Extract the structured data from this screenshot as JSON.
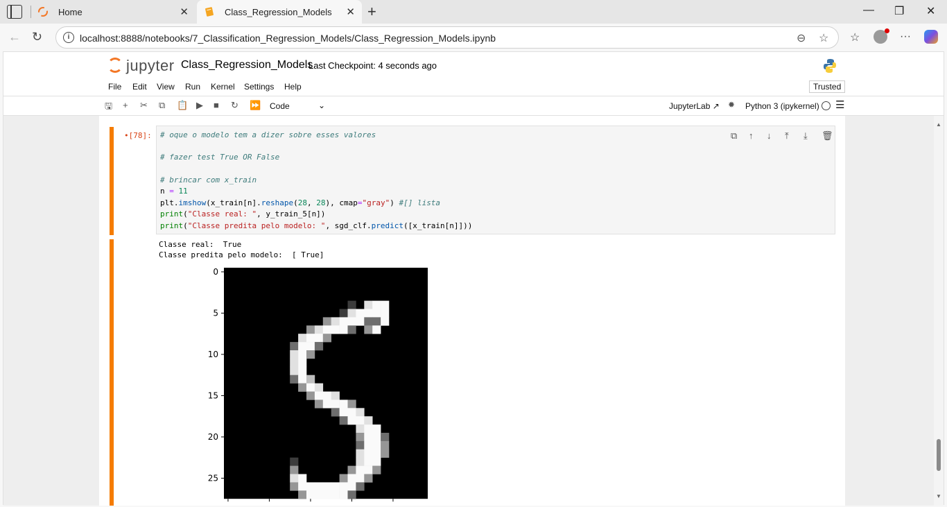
{
  "browser": {
    "tabs": [
      {
        "title": "Home",
        "active": false
      },
      {
        "title": "Class_Regression_Models",
        "active": true
      }
    ],
    "url": "localhost:8888/notebooks/7_Classification_Regression_Models/Class_Regression_Models.ipynb"
  },
  "jupyter": {
    "logo_text": "jupyter",
    "notebook_title": "Class_Regression_Models",
    "checkpoint": "Last Checkpoint: 4 seconds ago",
    "menu": [
      "File",
      "Edit",
      "View",
      "Run",
      "Kernel",
      "Settings",
      "Help"
    ],
    "trusted": "Trusted",
    "cell_type": "Code",
    "jupyterlab_link": "JupyterLab",
    "kernel": "Python 3 (ipykernel)"
  },
  "cell": {
    "prompt": "•[78]:",
    "code": [
      "# oque o modelo tem a dizer sobre esses valores",
      "",
      "# fazer test True OR False",
      "",
      "# brincar com x_train",
      "n = 11",
      "plt.imshow(x_train[n].reshape(28, 28), cmap=\"gray\") #[] lista",
      "print(\"Classe real: \", y_train_5[n])",
      "print(\"Classe predita pelo modelo: \", sgd_clf.predict([x_train[n]]))"
    ],
    "output": [
      "Classe real:  True",
      "Classe predita pelo modelo:  [ True]"
    ]
  },
  "chart_data": {
    "type": "heatmap",
    "title": "",
    "cmap": "gray",
    "ytick_labels": [
      "0",
      "5",
      "10",
      "15",
      "20",
      "25"
    ],
    "ytick_values": [
      0,
      5,
      10,
      15,
      20,
      25
    ],
    "shape": [
      28,
      28
    ],
    "digit_rows": [
      "............................",
      "............................",
      "............................",
      "............................",
      "...............a.eff........",
      "..............aeffff........",
      "............cefffbbf........",
      "..........cefffb.cf.........",
      ".........effc...............",
      "........bffb................",
      "........efc.................",
      "........ef..................",
      "........ef..................",
      "........bfd.................",
      ".........cfe................",
      "..........cffe..............",
      "...........cfffc............",
      ".............bffe...........",
      "..............bffe..........",
      "................eff.........",
      "................cffb........",
      "................bffc........",
      "................effc........",
      "........a.......eff.........",
      "........c......cffc.........",
      "........ef....cffc..........",
      "........cfffffffb...........",
      ".........cfffffb............"
    ],
    "levels": {
      ".": 0,
      "a": 60,
      "b": 110,
      "c": 150,
      "d": 190,
      "e": 225,
      "f": 250
    }
  }
}
